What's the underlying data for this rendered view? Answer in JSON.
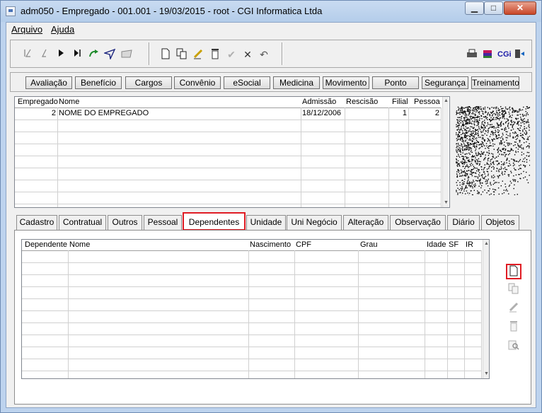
{
  "window": {
    "title": "adm050 - Empregado - 001.001 - 19/03/2015 - root - CGI Informatica Ltda",
    "minimize_glyph": "▁",
    "maximize_glyph": "□",
    "close_glyph": "✕"
  },
  "menu": {
    "items": [
      {
        "label": "Arquivo"
      },
      {
        "label": "Ajuda"
      }
    ]
  },
  "toolbar": {
    "nav_icons": [
      "first-record-icon",
      "previous-record-icon",
      "next-record-icon",
      "last-record-icon",
      "refresh-icon",
      "send-icon",
      "open-folder-icon"
    ],
    "edit_icons": [
      "new-document-icon",
      "copy-icon",
      "edit-icon",
      "delete-icon",
      "confirm-icon",
      "cancel-icon",
      "undo-icon"
    ],
    "right_icons": [
      "print-icon",
      "books-icon",
      "cgi-logo-icon",
      "exit-icon"
    ],
    "cgi_label": "CGi"
  },
  "modules": [
    {
      "label": "Avaliação"
    },
    {
      "label": "Benefício"
    },
    {
      "label": "Cargos"
    },
    {
      "label": "Convênio"
    },
    {
      "label": "eSocial"
    },
    {
      "label": "Medicina"
    },
    {
      "label": "Movimento"
    },
    {
      "label": "Ponto"
    },
    {
      "label": "Segurança"
    },
    {
      "label": "Treinamento"
    }
  ],
  "employees": {
    "columns": [
      "Empregado",
      "Nome",
      "Admissão",
      "Rescisão",
      "Filial",
      "Pessoa"
    ],
    "rows": [
      {
        "empregado": "2",
        "nome": "NOME DO EMPREGADO",
        "admissao": "18/12/2006",
        "rescisao": "",
        "filial": "1",
        "pessoa": "2"
      }
    ]
  },
  "tabs": [
    {
      "label": "Cadastro"
    },
    {
      "label": "Contratual"
    },
    {
      "label": "Outros"
    },
    {
      "label": "Pessoal"
    },
    {
      "label": "Dependentes",
      "active": true
    },
    {
      "label": "Unidade"
    },
    {
      "label": "Uni Negócio"
    },
    {
      "label": "Alteração"
    },
    {
      "label": "Observação"
    },
    {
      "label": "Diário"
    },
    {
      "label": "Objetos"
    }
  ],
  "dependents": {
    "columns": [
      "Dependente",
      "Nome",
      "Nascimento",
      "CPF",
      "Grau",
      "Idade",
      "SF",
      "IR"
    ],
    "rows": []
  },
  "side_actions": [
    "new-icon",
    "copy-icon",
    "edit-icon",
    "delete-icon",
    "search-icon"
  ]
}
